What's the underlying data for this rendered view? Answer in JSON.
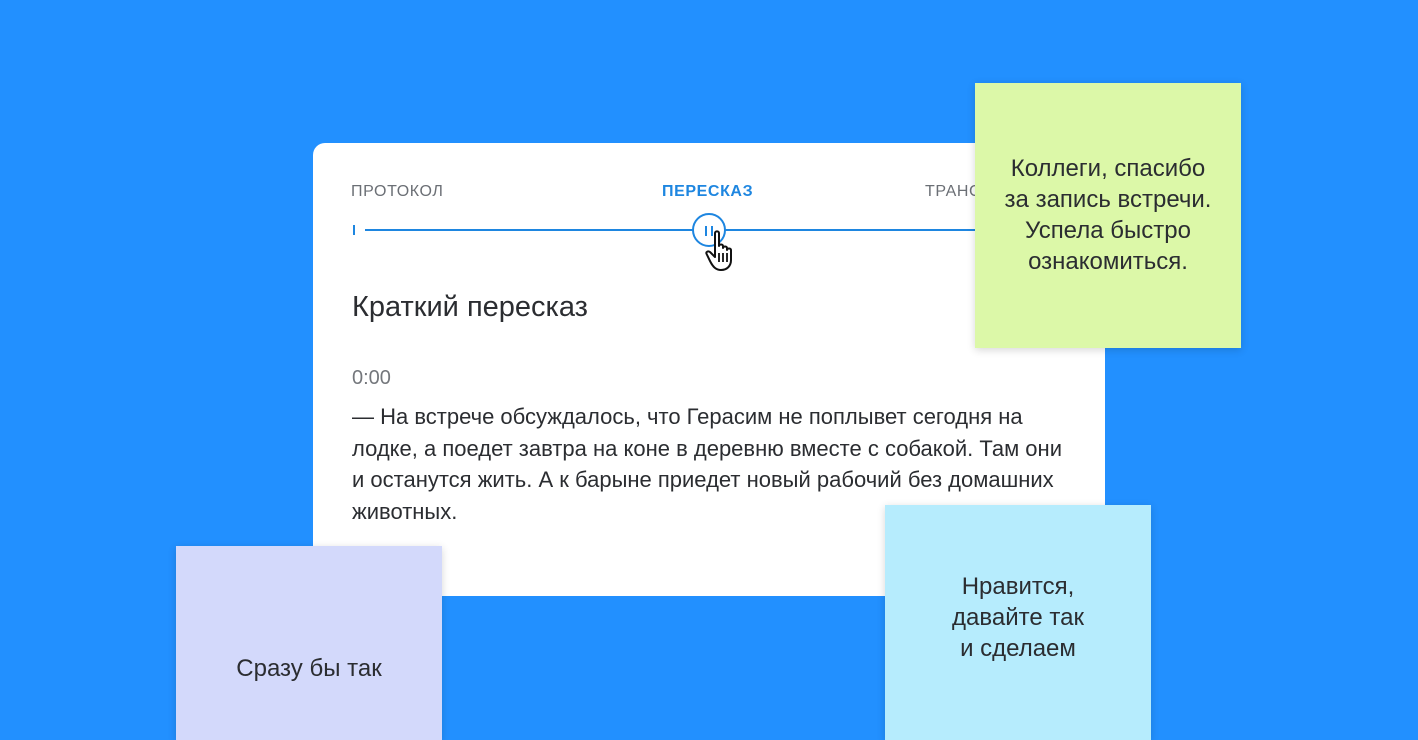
{
  "colors": {
    "background": "#2290ff",
    "accent": "#1e86e0",
    "card": "#ffffff",
    "note_green": "#dcf8a8",
    "note_lilac": "#d3d9fb",
    "note_blue": "#b6ecfd"
  },
  "tabs": [
    {
      "label": "ПРОТОКОЛ",
      "active": false
    },
    {
      "label": "ПЕРЕСКАЗ",
      "active": true
    },
    {
      "label": "ТРАНС",
      "active": false
    }
  ],
  "player": {
    "state": "playing",
    "button_icon": "pause-icon",
    "cursor_icon": "hand-pointer-icon"
  },
  "summary": {
    "title": "Краткий пересказ",
    "timestamp": "0:00",
    "text": "— На встрече обсуждалось, что Герасим не поплывет сегодня на лодке, а поедет завтра на коне в деревню вместе с собакой. Там они и останутся жить. А к барыне приедет новый рабочий без домашних животных."
  },
  "notes": [
    {
      "text": "Коллеги, спасибо\nза запись встречи.\nУспела быстро\nознакомиться.",
      "color": "#dcf8a8"
    },
    {
      "text": "Сразу бы так",
      "color": "#d3d9fb"
    },
    {
      "text": "Нравится,\nдавайте так\nи сделаем",
      "color": "#b6ecfd"
    }
  ]
}
